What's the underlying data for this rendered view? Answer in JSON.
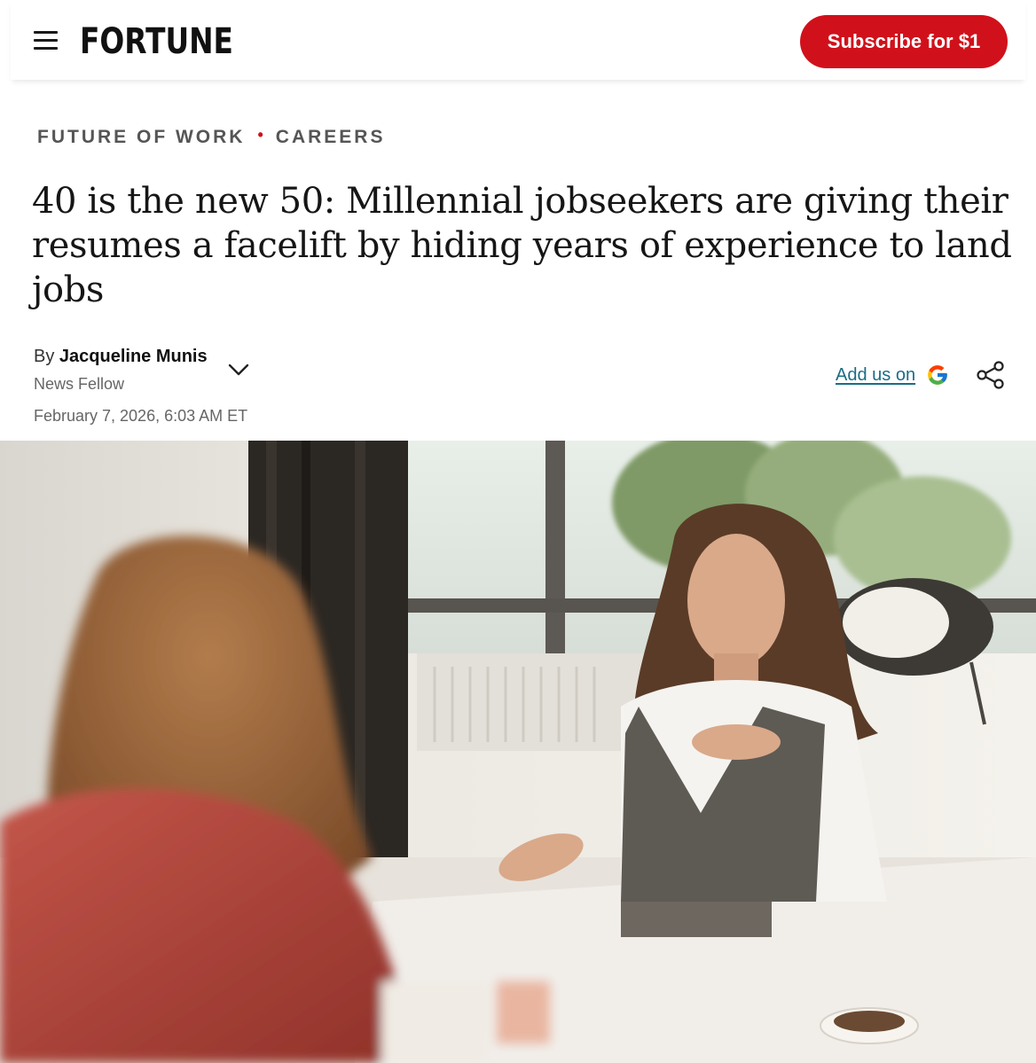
{
  "header": {
    "logo": "FORTUNE",
    "subscribe_label": "Subscribe for $1",
    "accent_color": "#d0111b"
  },
  "breadcrumb": {
    "items": [
      {
        "label": "FUTURE OF WORK"
      },
      {
        "label": "CAREERS"
      }
    ],
    "separator": "•"
  },
  "article": {
    "headline": "40 is the new 50: Millennial jobseekers are giving their resumes a facelift by hiding years of experience to land jobs",
    "byline_prefix": "By",
    "author": "Jacqueline Munis",
    "author_role": "News Fellow",
    "date": "February 7, 2026, 6:03 AM ET",
    "add_google_label": "Add us on"
  },
  "icons": {
    "menu": "hamburger-icon",
    "author_toggle": "chevron-down-icon",
    "google": "google-g-icon",
    "share": "share-icon"
  }
}
